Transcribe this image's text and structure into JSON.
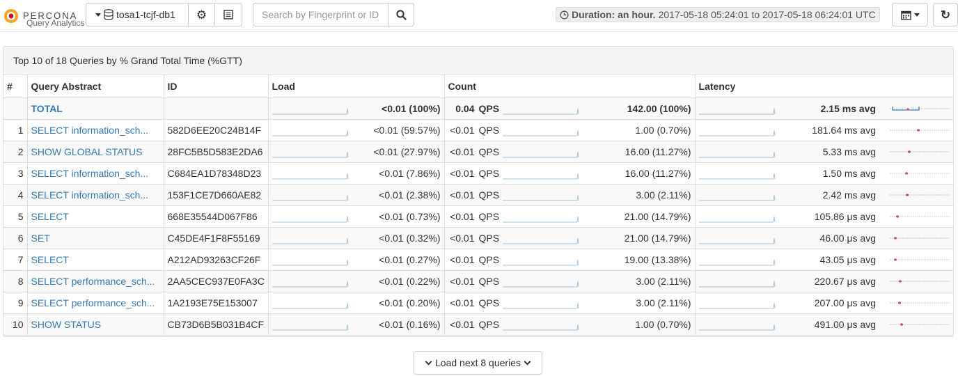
{
  "brand": {
    "name": "PERCONA",
    "subtitle": "Query Analytics"
  },
  "toolbar": {
    "instance": "tosa1-tcjf-db1",
    "search": {
      "value": "",
      "placeholder": "Search by Fingerprint or ID"
    },
    "duration_label": "Duration: an hour.",
    "duration_range": "2017-05-18 05:24:01 to 2017-05-18 06:24:01 UTC"
  },
  "panel": {
    "heading": "Top 10 of 18 Queries by % Grand Total Time (%GTT)"
  },
  "table": {
    "columns": [
      "#",
      "Query Abstract",
      "ID",
      "Load",
      "Count",
      "Latency"
    ],
    "total": {
      "label": "TOTAL",
      "load": "<0.01 (100%)",
      "qps": "0.04",
      "qps_unit": "QPS",
      "count": "142.00 (100%)",
      "latency": "2.15 ms avg"
    },
    "rows": [
      {
        "rank": "1",
        "abstract": "SELECT information_sch...",
        "id": "582D6EE20C24B14F",
        "load": "<0.01 (59.57%)",
        "qps": "<0.01",
        "qps_unit": "QPS",
        "count": "1.00 (0.70%)",
        "latency": "181.64 ms avg",
        "latency_pos": 0.48
      },
      {
        "rank": "2",
        "abstract": "SHOW GLOBAL STATUS",
        "id": "28FC5B5D583E2DA6",
        "load": "<0.01 (27.97%)",
        "qps": "<0.01",
        "qps_unit": "QPS",
        "count": "16.00 (11.27%)",
        "latency": "5.33 ms avg",
        "latency_pos": 0.32
      },
      {
        "rank": "3",
        "abstract": "SELECT information_sch...",
        "id": "C684EA1D78348D23",
        "load": "<0.01 (7.86%)",
        "qps": "<0.01",
        "qps_unit": "QPS",
        "count": "16.00 (11.27%)",
        "latency": "1.50 ms avg",
        "latency_pos": 0.28
      },
      {
        "rank": "4",
        "abstract": "SELECT information_sch...",
        "id": "153F1CE7D660AE82",
        "load": "<0.01 (2.38%)",
        "qps": "<0.01",
        "qps_unit": "QPS",
        "count": "3.00 (2.11%)",
        "latency": "2.42 ms avg",
        "latency_pos": 0.29
      },
      {
        "rank": "5",
        "abstract": "SELECT",
        "id": "668E35544D067F86",
        "load": "<0.01 (0.73%)",
        "qps": "<0.01",
        "qps_unit": "QPS",
        "count": "21.00 (14.79%)",
        "latency": "105.86 μs avg",
        "latency_pos": 0.13
      },
      {
        "rank": "6",
        "abstract": "SET",
        "id": "C45DE4F1F8F55169",
        "load": "<0.01 (0.32%)",
        "qps": "<0.01",
        "qps_unit": "QPS",
        "count": "21.00 (14.79%)",
        "latency": "46.00 μs avg",
        "latency_pos": 0.09
      },
      {
        "rank": "7",
        "abstract": "SELECT",
        "id": "A212AD93263CF26F",
        "load": "<0.01 (0.27%)",
        "qps": "<0.01",
        "qps_unit": "QPS",
        "count": "19.00 (13.38%)",
        "latency": "43.05 μs avg",
        "latency_pos": 0.09
      },
      {
        "rank": "8",
        "abstract": "SELECT performance_sch...",
        "id": "2AA5CEC937E0FA3C",
        "load": "<0.01 (0.22%)",
        "qps": "<0.01",
        "qps_unit": "QPS",
        "count": "3.00 (2.11%)",
        "latency": "220.67 μs avg",
        "latency_pos": 0.17
      },
      {
        "rank": "9",
        "abstract": "SELECT performance_sch...",
        "id": "1A2193E75E153007",
        "load": "<0.01 (0.20%)",
        "qps": "<0.01",
        "qps_unit": "QPS",
        "count": "3.00 (2.11%)",
        "latency": "207.00 μs avg",
        "latency_pos": 0.16
      },
      {
        "rank": "10",
        "abstract": "SHOW STATUS",
        "id": "CB73D6B5B031B4CF",
        "load": "<0.01 (0.16%)",
        "qps": "<0.01",
        "qps_unit": "QPS",
        "count": "1.00 (0.70%)",
        "latency": "491.00 μs avg",
        "latency_pos": 0.2
      }
    ]
  },
  "load_more": {
    "label": "Load next 8 queries"
  },
  "colors": {
    "link": "#337ab7",
    "sparkline": "#a8c4dc",
    "latency_marker": "#d9534f",
    "latency_marker_alt": "#337ab7"
  },
  "icons": [
    "percona-logo-icon",
    "caret-down-icon",
    "database-icon",
    "gear-icon",
    "list-icon",
    "search-icon",
    "clock-icon",
    "calendar-icon",
    "refresh-icon",
    "chevron-down-icon"
  ]
}
